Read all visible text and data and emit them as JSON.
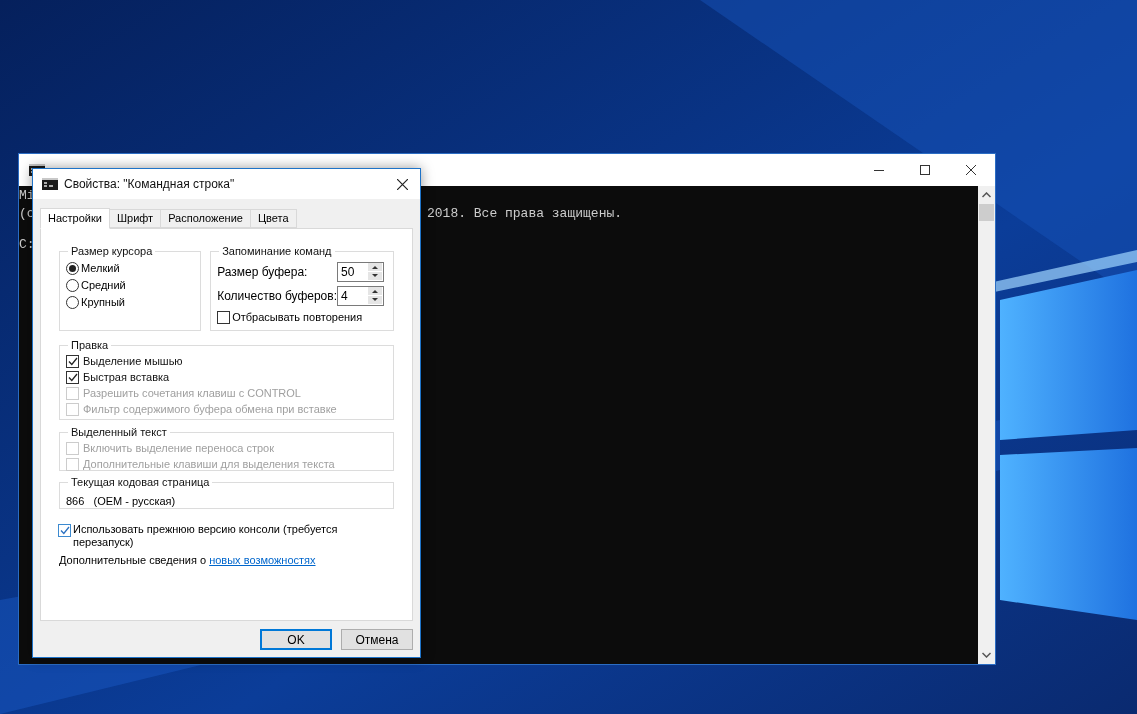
{
  "console": {
    "lines": [
      {
        "text": "Mi",
        "blank_before": false
      },
      {
        "text": "(c",
        "tail": "2018. Все права защищены.",
        "blank_before": false
      },
      {
        "text": "C:",
        "blank_before": true
      }
    ]
  },
  "dialog": {
    "title": "Свойства: \"Командная строка\"",
    "tabs": [
      {
        "label": "Настройки",
        "selected": true
      },
      {
        "label": "Шрифт",
        "selected": false
      },
      {
        "label": "Расположение",
        "selected": false
      },
      {
        "label": "Цвета",
        "selected": false
      }
    ],
    "cursor_size": {
      "title": "Размер курсора",
      "options": [
        {
          "label": "Мелкий",
          "selected": true
        },
        {
          "label": "Средний",
          "selected": false
        },
        {
          "label": "Крупный",
          "selected": false
        }
      ]
    },
    "history": {
      "title": "Запоминание команд",
      "fields": [
        {
          "label": "Размер буфера:",
          "value": "50"
        },
        {
          "label": "Количество буферов:",
          "value": "4"
        }
      ],
      "discard": {
        "label": "Отбрасывать повторения",
        "checked": false
      }
    },
    "edit": {
      "title": "Правка",
      "options": [
        {
          "label": "Выделение мышью",
          "checked": true,
          "disabled": false
        },
        {
          "label": "Быстрая вставка",
          "checked": true,
          "disabled": false
        },
        {
          "label": "Разрешить сочетания клавиш с CONTROL",
          "checked": false,
          "disabled": true
        },
        {
          "label": "Фильтр содержимого буфера обмена при вставке",
          "checked": false,
          "disabled": true
        }
      ]
    },
    "selection": {
      "title": "Выделенный текст",
      "options": [
        {
          "label": "Включить выделение переноса строк",
          "checked": false,
          "disabled": true
        },
        {
          "label": "Дополнительные клавиши для выделения текста",
          "checked": false,
          "disabled": true
        }
      ]
    },
    "codepage": {
      "title": "Текущая кодовая страница",
      "value": "866   (OEM - русская)"
    },
    "legacy": {
      "label": "Использовать прежнюю версию консоли (требуется перезапуск)",
      "checked": true
    },
    "info": {
      "text": "Дополнительные сведения о",
      "link": "новых возможностях"
    },
    "buttons": [
      {
        "label": "OK",
        "default": true
      },
      {
        "label": "Отмена",
        "default": false
      }
    ]
  }
}
